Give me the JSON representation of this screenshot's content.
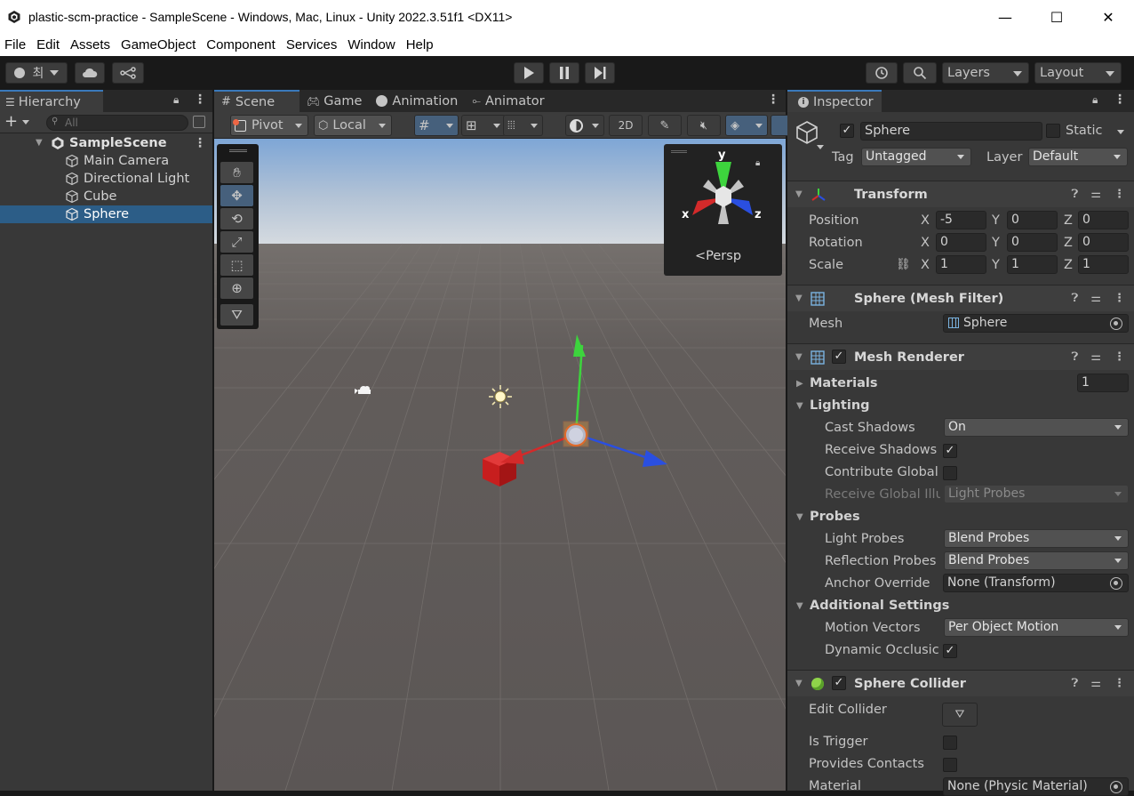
{
  "window": {
    "title": "plastic-scm-practice - SampleScene - Windows, Mac, Linux - Unity 2022.3.51f1 <DX11>",
    "minimize": "—",
    "maximize": "☐",
    "close": "✕"
  },
  "menu": [
    "File",
    "Edit",
    "Assets",
    "GameObject",
    "Component",
    "Services",
    "Window",
    "Help"
  ],
  "toolbar": {
    "account_label": "최",
    "layers_label": "Layers",
    "layout_label": "Layout"
  },
  "hierarchy": {
    "tab_label": "Hierarchy",
    "search_placeholder": "All",
    "scene_name": "SampleScene",
    "items": [
      {
        "label": "Main Camera"
      },
      {
        "label": "Directional Light"
      },
      {
        "label": "Cube"
      },
      {
        "label": "Sphere",
        "selected": true
      }
    ]
  },
  "scene_tabs": {
    "scene": "Scene",
    "game": "Game",
    "animation": "Animation",
    "animator": "Animator"
  },
  "scene_toolbar": {
    "pivot": "Pivot",
    "local": "Local",
    "mode_2d": "2D"
  },
  "gizmo": {
    "y": "y",
    "x": "x",
    "z": "z",
    "projection": "<Persp"
  },
  "inspector": {
    "tab_label": "Inspector",
    "object_name": "Sphere",
    "static_label": "Static",
    "tag_label": "Tag",
    "tag_value": "Untagged",
    "layer_label": "Layer",
    "layer_value": "Default",
    "transform": {
      "title": "Transform",
      "position_label": "Position",
      "rotation_label": "Rotation",
      "scale_label": "Scale",
      "position": {
        "x": "-5",
        "y": "0",
        "z": "0"
      },
      "rotation": {
        "x": "0",
        "y": "0",
        "z": "0"
      },
      "scale": {
        "x": "1",
        "y": "1",
        "z": "1"
      },
      "x": "X",
      "y": "Y",
      "z": "Z"
    },
    "mesh_filter": {
      "title": "Sphere (Mesh Filter)",
      "mesh_label": "Mesh",
      "mesh_value": "Sphere"
    },
    "mesh_renderer": {
      "title": "Mesh Renderer",
      "materials_label": "Materials",
      "materials_count": "1",
      "lighting_label": "Lighting",
      "cast_shadows_label": "Cast Shadows",
      "cast_shadows_value": "On",
      "receive_shadows_label": "Receive Shadows",
      "contribute_gi_label": "Contribute Global",
      "receive_gi_label": "Receive Global Illu",
      "receive_gi_value": "Light Probes",
      "probes_label": "Probes",
      "light_probes_label": "Light Probes",
      "light_probes_value": "Blend Probes",
      "reflection_probes_label": "Reflection Probes",
      "reflection_probes_value": "Blend Probes",
      "anchor_override_label": "Anchor Override",
      "anchor_override_value": "None (Transform)",
      "additional_label": "Additional Settings",
      "motion_vectors_label": "Motion Vectors",
      "motion_vectors_value": "Per Object Motion",
      "dynamic_occlusion_label": "Dynamic Occlusic"
    },
    "sphere_collider": {
      "title": "Sphere Collider",
      "edit_collider_label": "Edit Collider",
      "is_trigger_label": "Is Trigger",
      "provides_contacts_label": "Provides Contacts",
      "material_label": "Material",
      "material_value": "None (Physic Material)"
    }
  },
  "colors": {
    "selection": "#2c5d87",
    "accent_tab": "#3a79bb",
    "axis_x": "#d32a2a",
    "axis_y": "#3dd43d",
    "axis_z": "#2a4fe0"
  }
}
